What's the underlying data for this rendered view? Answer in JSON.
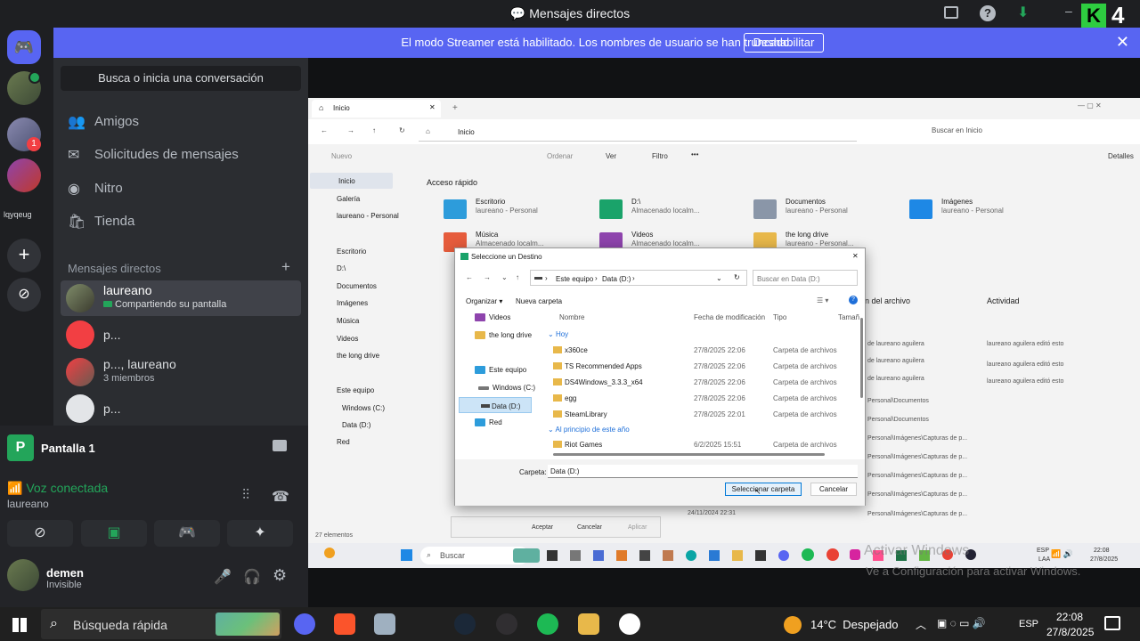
{
  "window": {
    "title": "Mensajes directos"
  },
  "banner": {
    "message": "El modo Streamer está habilitado. Los nombres de usuario se han truncado.",
    "button": "Deshabilitar"
  },
  "rail": {
    "label": "lqyqeug"
  },
  "search": {
    "placeholder": "Busca o inicia una conversación"
  },
  "nav": [
    {
      "label": "Amigos",
      "icon": "friends-icon"
    },
    {
      "label": "Solicitudes de mensajes",
      "icon": "mail-icon"
    },
    {
      "label": "Nitro",
      "icon": "nitro-icon"
    },
    {
      "label": "Tienda",
      "icon": "shop-icon"
    }
  ],
  "dm_header": {
    "label": "Mensajes directos",
    "add": "+"
  },
  "dms": [
    {
      "name": "laureano",
      "status": "Compartiendo su pantalla"
    },
    {
      "name": "p...",
      "status": ""
    },
    {
      "name": "p..., laureano",
      "status": "3 miembros"
    },
    {
      "name": "p...",
      "status": ""
    }
  ],
  "stream": {
    "title": "Pantalla 1"
  },
  "voice": {
    "status": "Voz conectada",
    "channel": "laureano"
  },
  "user": {
    "name": "demen",
    "status": "Invisible"
  },
  "explorer": {
    "tab": "Inicio",
    "address": "Inicio",
    "search": "Buscar en Inicio",
    "toolbar": {
      "new": "Nuevo",
      "sort": "Ordenar",
      "view": "Ver",
      "filter": "Filtro",
      "details": "Detalles"
    },
    "nav": [
      "Inicio",
      "Galería",
      "laureano - Personal",
      "Escritorio",
      "D:\\",
      "Documentos",
      "Imágenes",
      "Música",
      "Videos",
      "the long drive",
      "Este equipo",
      "Windows (C:)",
      "Data (D:)",
      "Red"
    ],
    "quick_access": "Acceso rápido",
    "tiles": [
      {
        "name": "Escritorio",
        "sub": "laureano - Personal"
      },
      {
        "name": "D:\\",
        "sub": "Almacenado localm..."
      },
      {
        "name": "Documentos",
        "sub": "laureano - Personal"
      },
      {
        "name": "Imágenes",
        "sub": "laureano - Personal"
      },
      {
        "name": "Música",
        "sub": "Almacenado localm..."
      },
      {
        "name": "Videos",
        "sub": "Almacenado localm..."
      },
      {
        "name": "the long drive",
        "sub": "laureano - Personal..."
      }
    ],
    "cols": {
      "loc": "n del archivo",
      "act": "Actividad"
    },
    "activity": [
      "laureano aguilera editó esto",
      "laureano aguilera editó esto",
      "laureano aguilera editó esto"
    ],
    "locations": [
      "de laureano aguilera",
      "de laureano aguilera",
      "de laureano aguilera",
      "Personal\\Documentos",
      "Personal\\Documentos",
      "Personal\\Imágenes\\Capturas de p...",
      "Personal\\Imágenes\\Capturas de p...",
      "Personal\\Imágenes\\Capturas de p...",
      "Personal\\Imágenes\\Capturas de p...",
      "Personal\\Imágenes\\Capturas de p..."
    ],
    "date": "24/11/2024 22:31",
    "count": "27 elementos",
    "back_buttons": [
      "Aceptar",
      "Cancelar",
      "Aplicar"
    ]
  },
  "dialog": {
    "title": "Seleccione un Destino",
    "path": [
      "Este equipo",
      "Data (D:)"
    ],
    "search": "Buscar en Data (D:)",
    "organize": "Organizar",
    "new_folder": "Nueva carpeta",
    "side": [
      "Videos",
      "the long drive",
      "Este equipo",
      "Windows (C:)",
      "Data (D:)",
      "Red"
    ],
    "headers": [
      "Nombre",
      "Fecha de modificación",
      "Tipo",
      "Tamañ"
    ],
    "groups": [
      "Hoy",
      "Al principio de este año"
    ],
    "rows": [
      {
        "name": "x360ce",
        "date": "27/8/2025 22:06",
        "type": "Carpeta de archivos"
      },
      {
        "name": "TS Recommended Apps",
        "date": "27/8/2025 22:06",
        "type": "Carpeta de archivos"
      },
      {
        "name": "DS4Windows_3.3.3_x64",
        "date": "27/8/2025 22:06",
        "type": "Carpeta de archivos"
      },
      {
        "name": "egg",
        "date": "27/8/2025 22:06",
        "type": "Carpeta de archivos"
      },
      {
        "name": "SteamLibrary",
        "date": "27/8/2025 22:01",
        "type": "Carpeta de archivos"
      },
      {
        "name": "Riot Games",
        "date": "6/2/2025 15:51",
        "type": "Carpeta de archivos"
      }
    ],
    "folder_label": "Carpeta:",
    "folder_value": "Data (D:)",
    "select": "Seleccionar carpeta",
    "cancel": "Cancelar"
  },
  "inner_taskbar": {
    "search": "Buscar",
    "lang": "ESP",
    "lang2": "LAA",
    "time": "22:08",
    "date": "27/8/2025",
    "watermark": "Activar Windows",
    "watermark2": "Ve a Configuración para activar Windows."
  },
  "taskbar": {
    "search": "Búsqueda rápida",
    "weather": "14°C  Despejado",
    "lang": "ESP",
    "time": "22:08",
    "date": "27/8/2025"
  }
}
